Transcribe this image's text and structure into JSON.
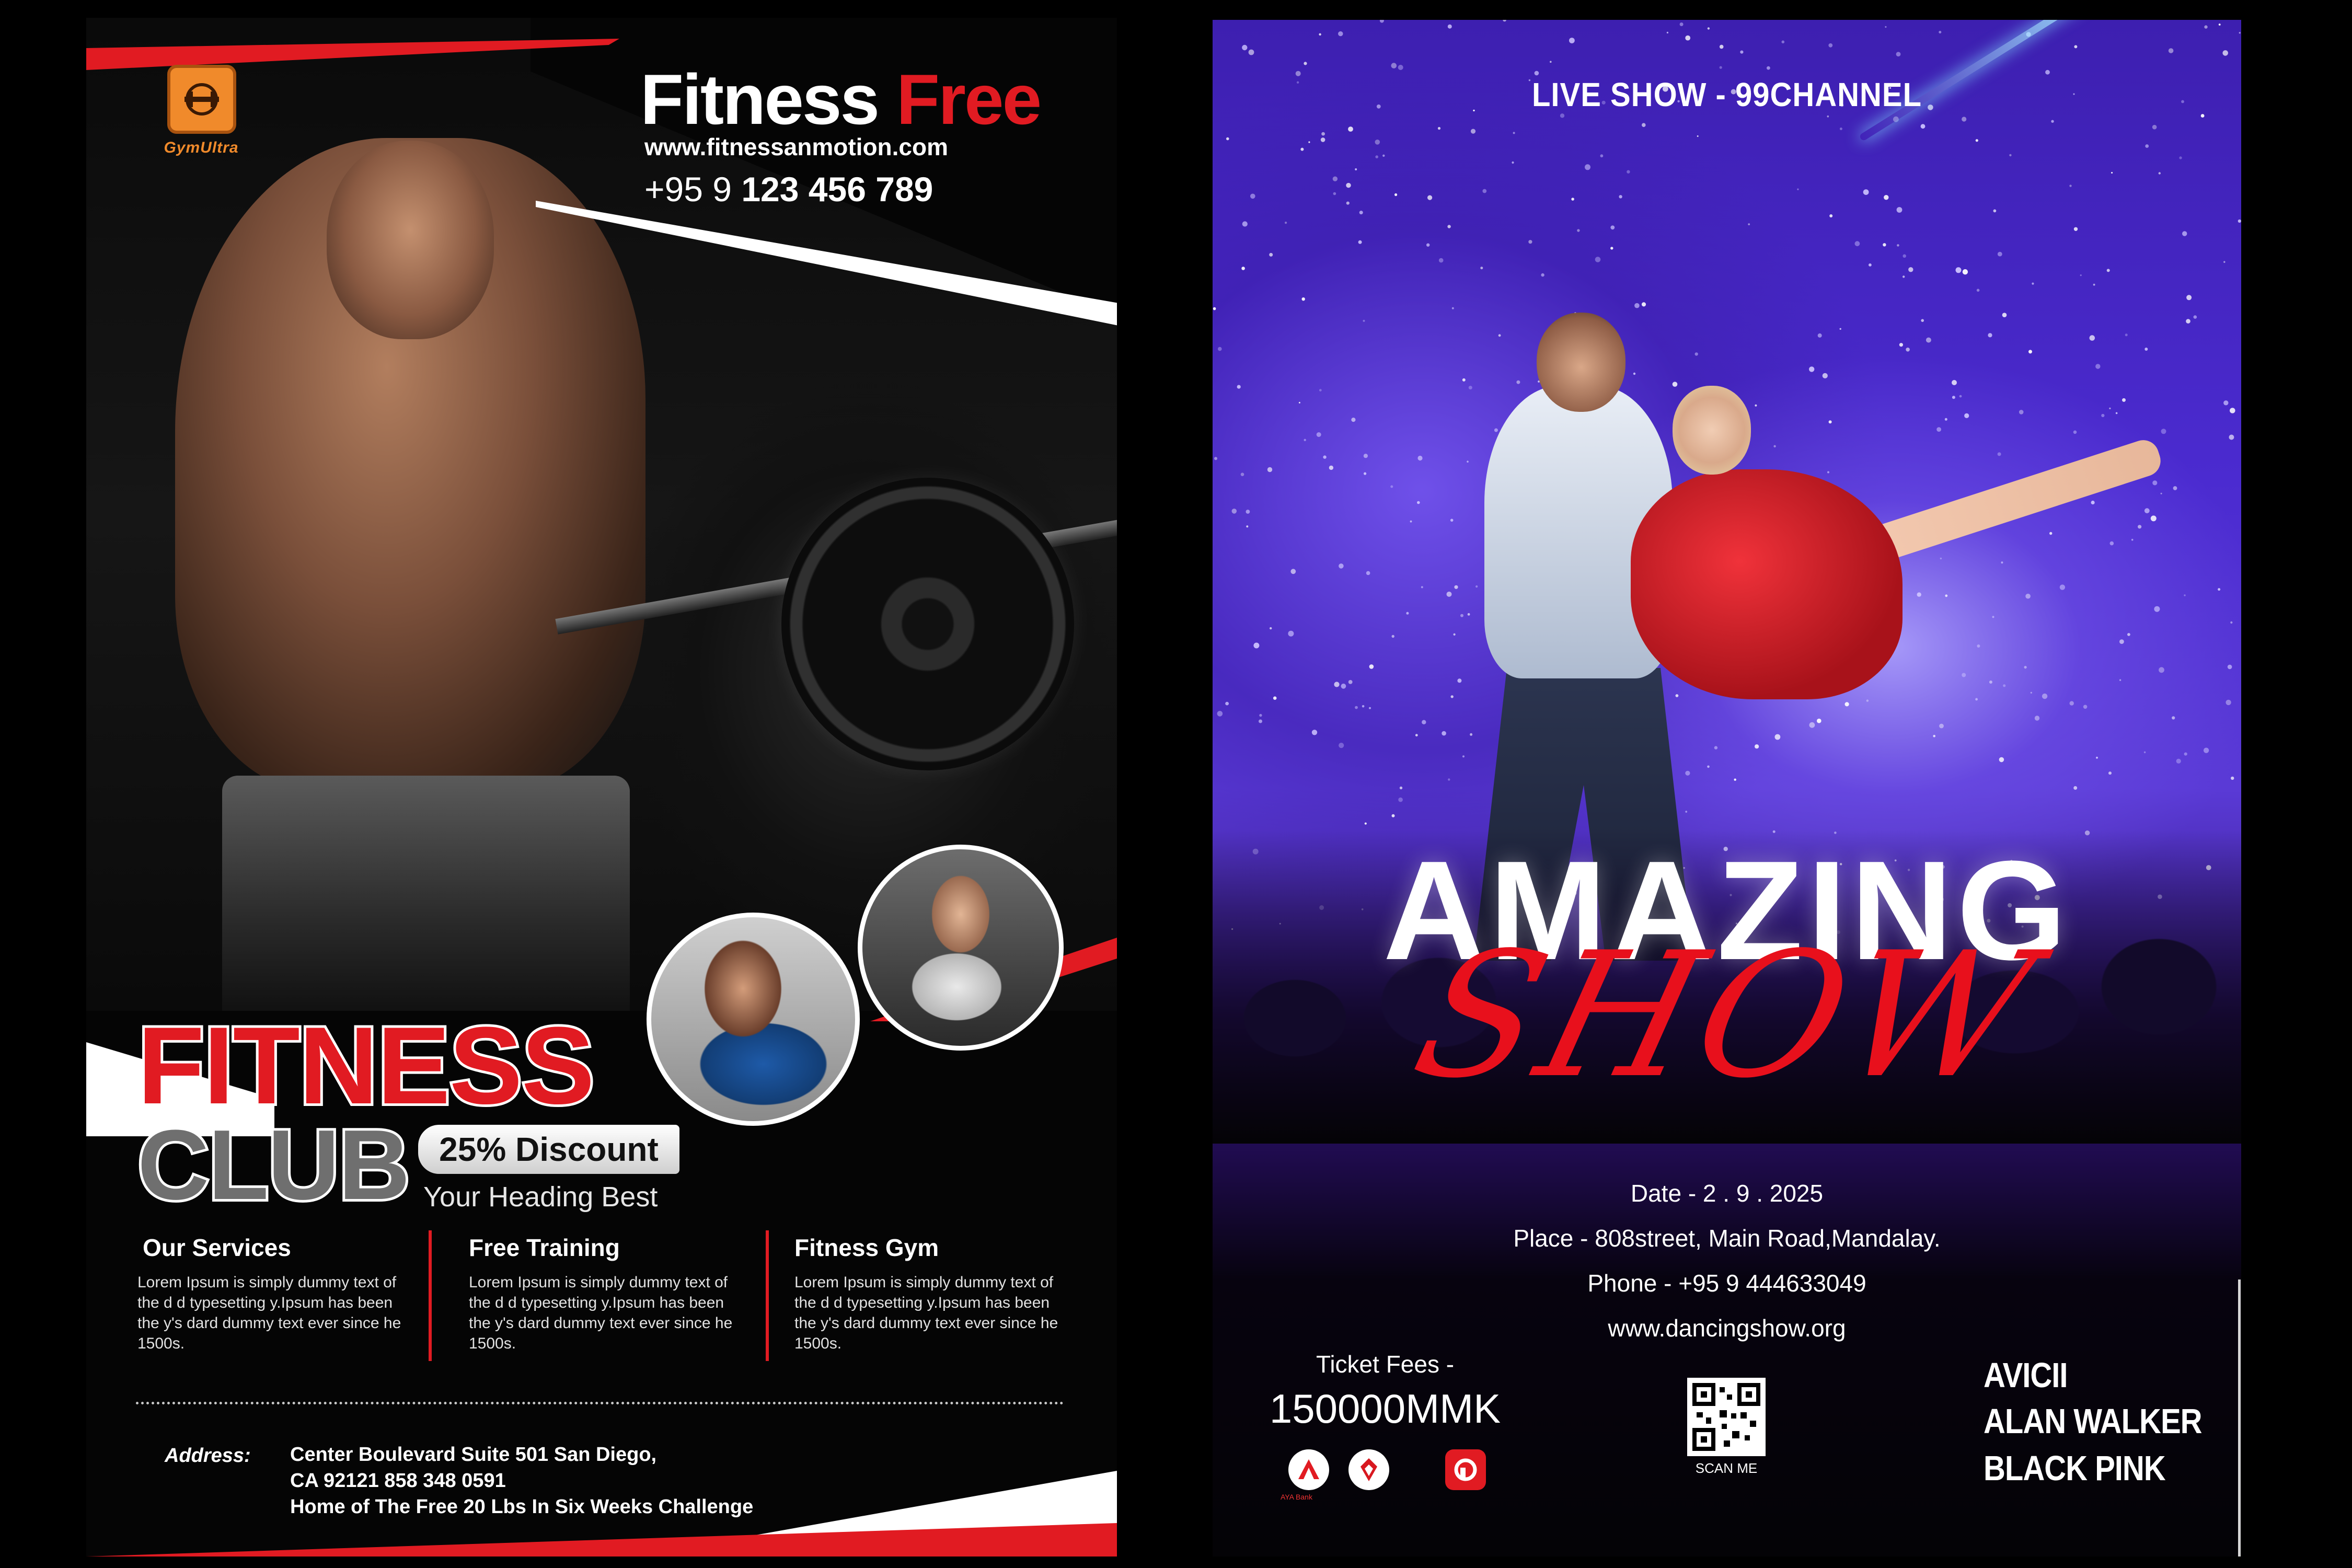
{
  "left_flyer": {
    "logo_text": "GymUltra",
    "headline_white": "Fitness ",
    "headline_red": "Free",
    "website": "www.fitnessanmotion.com",
    "phone_prefix": "+95 9 ",
    "phone_number": "123 456 789",
    "title_line1": "FITNESS",
    "title_line2": "CLUB",
    "discount": "25% Discount",
    "subheading": "Your Heading Best",
    "services": [
      {
        "title": "Our Services",
        "body": "Lorem Ipsum is simply dummy text of the d d typesetting y.Ipsum has been the y's dard dummy text ever since he 1500s."
      },
      {
        "title": "Free Training",
        "body": "Lorem Ipsum is simply dummy text of the d d typesetting y.Ipsum has been the y's dard dummy text ever since he 1500s."
      },
      {
        "title": "Fitness Gym",
        "body": "Lorem Ipsum is simply dummy text of the d d typesetting y.Ipsum has been the y's dard dummy text ever since he 1500s."
      }
    ],
    "address_label": "Address:",
    "address_lines": [
      "Center Boulevard Suite 501 San Diego,",
      "CA 92121  858 348 0591",
      "Home of The Free 20 Lbs In Six Weeks Challenge"
    ],
    "colors": {
      "accent": "#e11b22",
      "logo": "#f08a2b"
    }
  },
  "right_flyer": {
    "top_label": "LIVE SHOW - 99CHANNEL",
    "title_line1": "AMAZING",
    "title_line2": "SHOW",
    "date": "Date - 2 . 9 . 2025",
    "place": "Place - 808street, Main Road,Mandalay.",
    "phone": "Phone - +95 9 444633049",
    "website": "www.dancingshow.org",
    "ticket_label": "Ticket Fees -",
    "ticket_price": "150000MMK",
    "bank_caption": "AYA Bank",
    "qr_caption": "SCAN ME",
    "artists": [
      "AVICII",
      "ALAN WALKER",
      "BLACK PINK"
    ],
    "colors": {
      "title_red": "#e8101c",
      "background_purple": "#4b2bd0"
    }
  }
}
